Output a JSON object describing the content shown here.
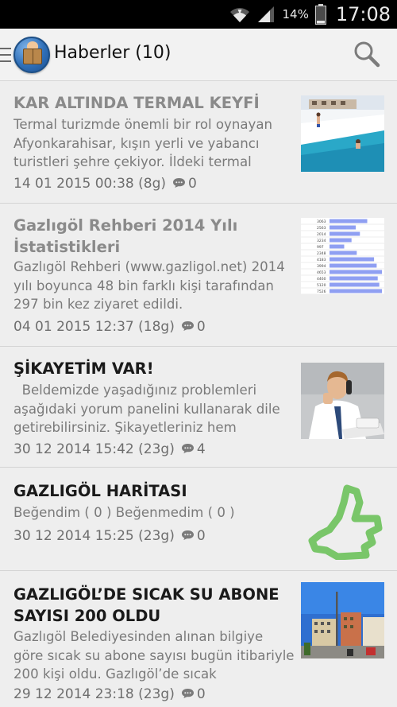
{
  "status_bar": {
    "battery": "14%",
    "time": "17:08"
  },
  "header": {
    "title": "Haberler (10)"
  },
  "icons": {
    "drawer": "drawer-icon",
    "app_logo": "reader-logo-icon",
    "search": "search-icon",
    "comment": "comment-icon"
  },
  "articles": [
    {
      "title": "KAR ALTINDA TERMAL KEYFİ",
      "summary": "Termal turizmde önemli bir rol oynayan Afyonkarahisar, kışın yerli ve yabancı turistleri şehre çekiyor. İldeki termal",
      "date": "14 01 2015 00:38 (8g)",
      "comments": "0",
      "read": true,
      "thumbnail": "pool-in-snow-photo"
    },
    {
      "title": "Gazlıgöl Rehberi 2014 Yılı İstatistikleri",
      "summary": "Gazlıgöl Rehberi (www.gazligol.net) 2014 yılı boyunca 48 bin farklı kişi tarafından   297 bin kez ziyaret edildi.",
      "date": "04 01 2015 12:37 (18g)",
      "comments": "0",
      "read": true,
      "thumbnail": "statistics-table-image"
    },
    {
      "title": "ŞİKAYETİM VAR!",
      "summary": "  Beldemizde yaşadığınız problemleri aşağıdaki yorum panelini kullanarak dile getirebilirsiniz. Şikayetleriniz hem",
      "date": "30 12 2014 15:42 (23g)",
      "comments": "4",
      "read": false,
      "thumbnail": "man-on-phone-photo"
    },
    {
      "title": "GAZLIGÖL HARİTASI",
      "summary": "Beğendim ( 0 ) Beğenmedim ( 0 )",
      "date": "30 12 2014 15:25 (23g)",
      "comments": "0",
      "read": false,
      "thumbnail": "thumbs-up-image"
    },
    {
      "title": "GAZLIGÖL’DE SICAK SU ABONE SAYISI 200 OLDU",
      "summary": "Gazlıgöl Belediyesinden alınan bilgiye göre sıcak su abone sayısı bugün itibariyle 200 kişi oldu. Gazlıgöl’de sıcak",
      "date": "29 12 2014 23:18 (23g)",
      "comments": "0",
      "read": false,
      "thumbnail": "town-street-photo"
    }
  ],
  "stats_table": [
    "3063",
    "2563",
    "2014",
    "3234",
    "997",
    "2348",
    "4183",
    "3994",
    "4653",
    "4460",
    "5120",
    "7526"
  ],
  "stats_bars": [
    0.72,
    0.5,
    0.58,
    0.42,
    0.28,
    0.52,
    0.85,
    0.9,
    1.0,
    0.92,
    0.95,
    1.0
  ],
  "colors": {
    "read_title": "#8a8a8a",
    "unread_title": "#1a1a1a",
    "background": "#eeeeee"
  }
}
